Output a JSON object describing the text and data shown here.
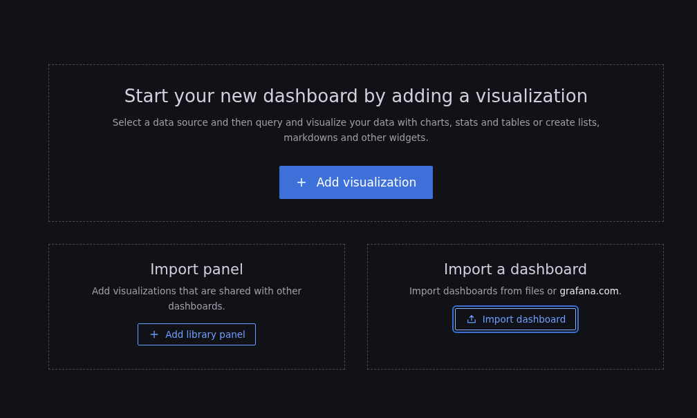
{
  "hero": {
    "title": "Start your new dashboard by adding a visualization",
    "description": "Select a data source and then query and visualize your data with charts, stats and tables or create lists, markdowns and other widgets.",
    "button": {
      "label": "Add visualization"
    }
  },
  "cards": [
    {
      "kind": "library",
      "title": "Import panel",
      "description": "Add visualizations that are shared with other dashboards.",
      "button": {
        "label": "Add library panel",
        "focused": false
      }
    },
    {
      "kind": "import",
      "title": "Import a dashboard",
      "description": "Import dashboards from files or ",
      "link": "grafana.com",
      "description_end": ".",
      "button": {
        "label": "Import dashboard",
        "focused": true
      }
    }
  ]
}
